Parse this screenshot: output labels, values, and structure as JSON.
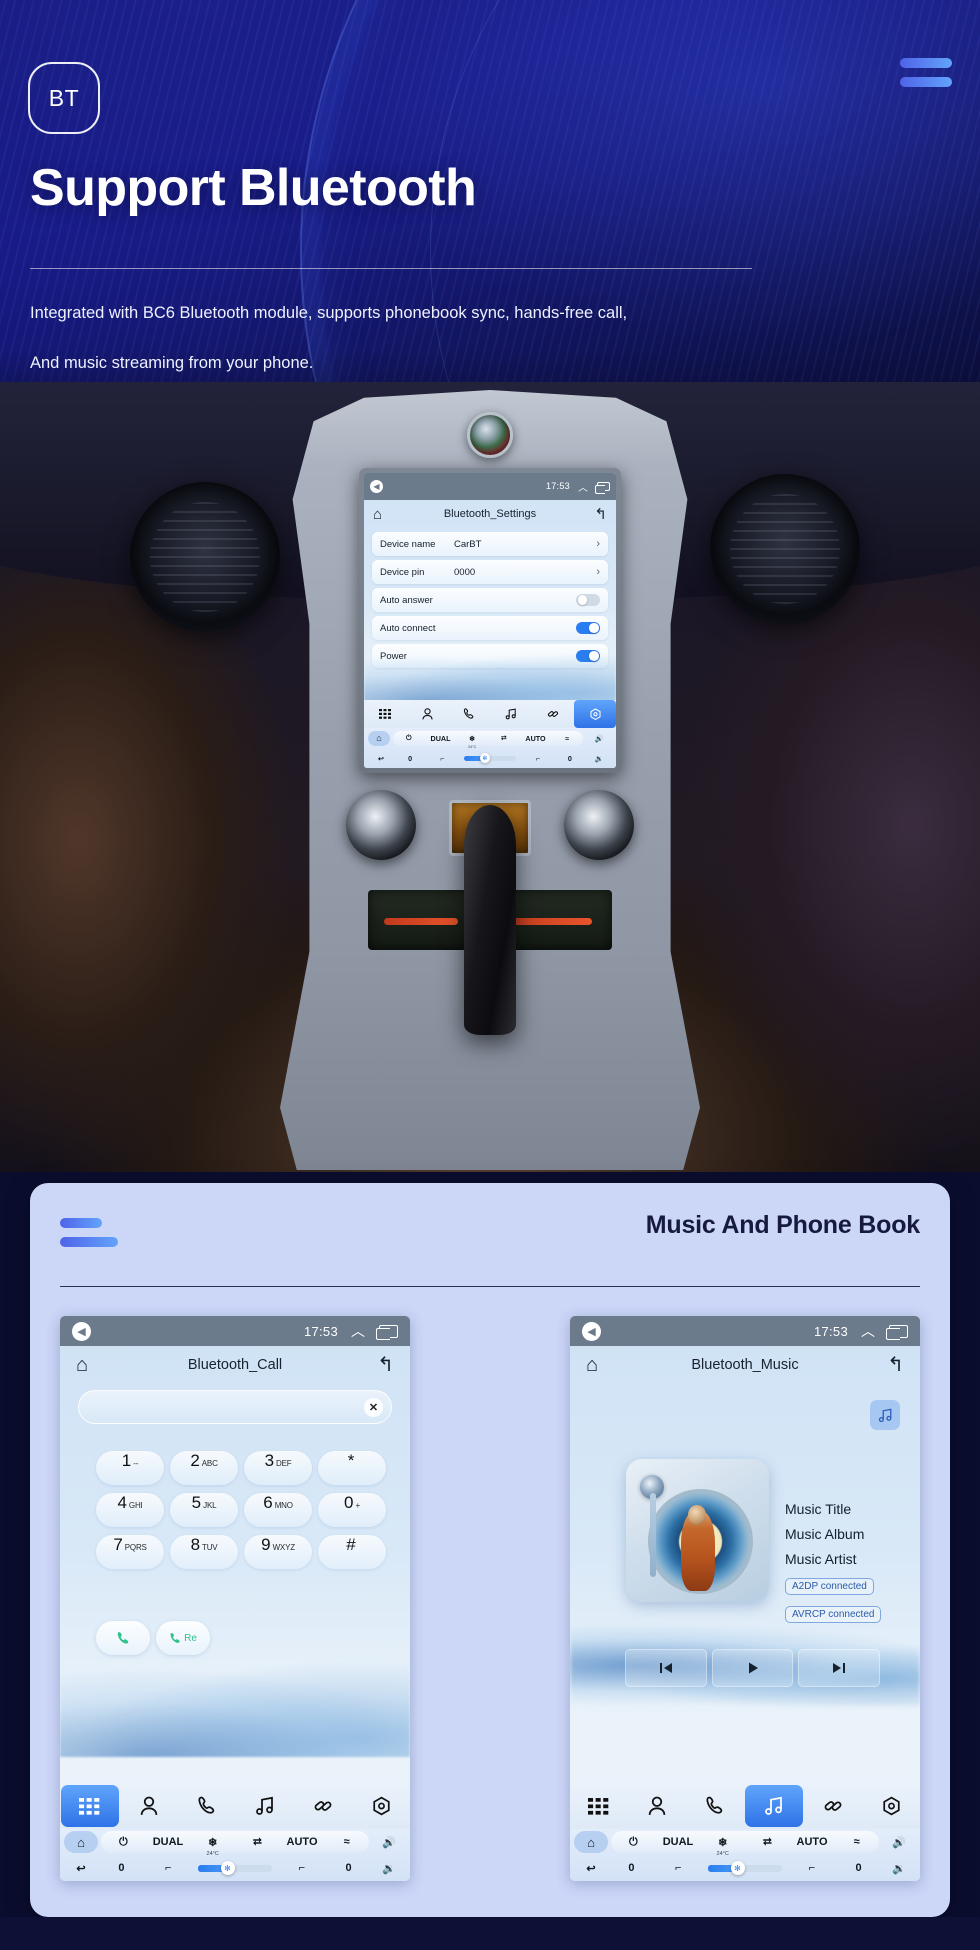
{
  "hero": {
    "badge": "BT",
    "menu_icon": "hamburger-icon",
    "title": "Support Bluetooth",
    "subtitle_line1": "Integrated with BC6 Bluetooth module, supports phonebook sync, hands-free call,",
    "subtitle_line2": "And music streaming from your phone."
  },
  "main_screen": {
    "status": {
      "speaker_icon": "speaker-icon",
      "time": "17:53",
      "chevron_icon": "chevron-up-icon",
      "window_icon": "recent-apps-icon"
    },
    "home_icon": "home-icon",
    "title": "Bluetooth_Settings",
    "back_icon": "back-arrow-icon",
    "rows": [
      {
        "label": "Device name",
        "value": "CarBT",
        "control": "arrow"
      },
      {
        "label": "Device pin",
        "value": "0000",
        "control": "arrow"
      },
      {
        "label": "Auto answer",
        "value": "",
        "control": "toggle-off"
      },
      {
        "label": "Auto connect",
        "value": "",
        "control": "toggle-on"
      },
      {
        "label": "Power",
        "value": "",
        "control": "toggle-on"
      }
    ],
    "tabs": [
      {
        "icon": "apps-grid-icon",
        "glyph": "☷",
        "active": false
      },
      {
        "icon": "contacts-icon",
        "glyph": "\u0000",
        "active": false
      },
      {
        "icon": "phone-icon",
        "glyph": "\u0000",
        "active": false
      },
      {
        "icon": "music-note-icon",
        "glyph": "\u0000",
        "active": false
      },
      {
        "icon": "link-icon",
        "glyph": "\u0000",
        "active": false
      },
      {
        "icon": "settings-hex-icon",
        "glyph": "\u0000",
        "active": true
      }
    ],
    "hvac": {
      "home_icon": "home-icon",
      "power_icon": "power-icon",
      "dual": "DUAL",
      "snowflake_icon": "snowflake-icon",
      "recirc_icon": "recirculate-icon",
      "auto": "AUTO",
      "defrost_icon": "defrost-icon",
      "volume_up_icon": "volume-up-icon",
      "volume_down_icon": "volume-down-icon",
      "back_icon": "back-arrow-icon",
      "left_value": "0",
      "right_value": "0",
      "seat_icon": "seat-icon",
      "seat_heat_icon": "seat-heat-icon",
      "temperature": "24°C",
      "fan_icon": "fan-icon"
    }
  },
  "card": {
    "title": "Music And Phone Book",
    "bars_icon": "decorative-bars-icon"
  },
  "call_screen": {
    "status": {
      "speaker_icon": "speaker-icon",
      "time": "17:53",
      "chevron_icon": "chevron-up-icon",
      "window_icon": "recent-apps-icon"
    },
    "home_icon": "home-icon",
    "title": "Bluetooth_Call",
    "back_icon": "back-arrow-icon",
    "input": {
      "value": "",
      "placeholder": "",
      "clear_icon": "close-x-icon"
    },
    "keys": [
      {
        "digit": "1",
        "sub": "--"
      },
      {
        "digit": "2",
        "sub": "ABC"
      },
      {
        "digit": "3",
        "sub": "DEF"
      },
      {
        "digit": "*",
        "sub": ""
      },
      {
        "digit": "4",
        "sub": "GHI"
      },
      {
        "digit": "5",
        "sub": "JKL"
      },
      {
        "digit": "6",
        "sub": "MNO"
      },
      {
        "digit": "0",
        "sub": "+"
      },
      {
        "digit": "7",
        "sub": "PQRS"
      },
      {
        "digit": "8",
        "sub": "TUV"
      },
      {
        "digit": "9",
        "sub": "WXYZ"
      },
      {
        "digit": "#",
        "sub": ""
      }
    ],
    "call_button": {
      "icon": "phone-call-icon",
      "label": ""
    },
    "redial_button": {
      "icon": "phone-call-icon",
      "label": "Re"
    },
    "tabs": [
      {
        "icon": "apps-grid-icon",
        "active": true
      },
      {
        "icon": "contacts-icon",
        "active": false
      },
      {
        "icon": "phone-icon",
        "active": false
      },
      {
        "icon": "music-note-icon",
        "active": false
      },
      {
        "icon": "link-icon",
        "active": false
      },
      {
        "icon": "settings-hex-icon",
        "active": false
      }
    ],
    "hvac": {
      "dual": "DUAL",
      "auto": "AUTO",
      "temperature": "24°C",
      "left_value": "0",
      "right_value": "0"
    }
  },
  "music_screen": {
    "status": {
      "speaker_icon": "speaker-icon",
      "time": "17:53",
      "chevron_icon": "chevron-up-icon",
      "window_icon": "recent-apps-icon"
    },
    "home_icon": "home-icon",
    "title": "Bluetooth_Music",
    "back_icon": "back-arrow-icon",
    "source_badge_icon": "music-note-icon",
    "meta": {
      "title": "Music Title",
      "album": "Music Album",
      "artist": "Music Artist"
    },
    "chips": [
      "A2DP  connected",
      "AVRCP connected"
    ],
    "controls": [
      {
        "icon": "previous-track-icon",
        "glyph": "⏮"
      },
      {
        "icon": "play-icon",
        "glyph": "▶"
      },
      {
        "icon": "next-track-icon",
        "glyph": "⏭"
      }
    ],
    "tabs": [
      {
        "icon": "apps-grid-icon",
        "active": false
      },
      {
        "icon": "contacts-icon",
        "active": false
      },
      {
        "icon": "phone-icon",
        "active": false
      },
      {
        "icon": "music-note-icon",
        "active": true
      },
      {
        "icon": "link-icon",
        "active": false
      },
      {
        "icon": "settings-hex-icon",
        "active": false
      }
    ],
    "hvac": {
      "dual": "DUAL",
      "auto": "AUTO",
      "temperature": "24°C",
      "left_value": "0",
      "right_value": "0"
    }
  },
  "colors": {
    "hero_bg": "#16197a",
    "accent_blue": "#2a7df0",
    "card_bg": "#ccd6f7",
    "title_dark": "#161a3f",
    "green_call": "#2fc38a"
  }
}
